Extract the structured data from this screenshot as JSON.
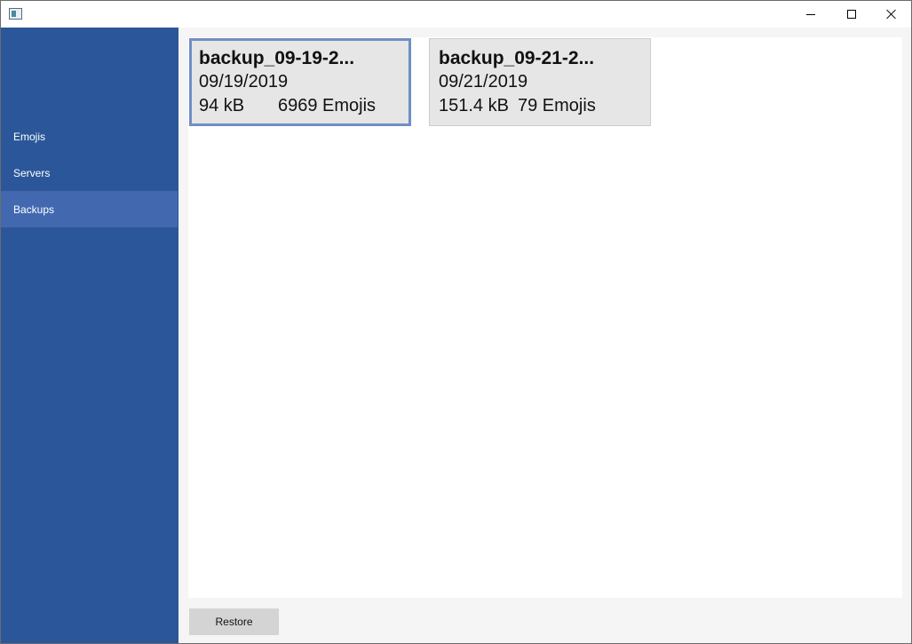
{
  "titlebar": {
    "app_icon": "window-app-icon",
    "buttons": [
      "minimize-icon",
      "maximize-icon",
      "close-icon"
    ]
  },
  "sidebar": {
    "items": [
      {
        "label": "Emojis",
        "active": false
      },
      {
        "label": "Servers",
        "active": false
      },
      {
        "label": "Backups",
        "active": true
      }
    ],
    "color": "#2b579a",
    "active_color": "#4269b0"
  },
  "backups": [
    {
      "name": "backup_09-19-2...",
      "date": "09/19/2019",
      "size": "94 kB",
      "emojis": "6969 Emojis",
      "selected": true
    },
    {
      "name": "backup_09-21-2...",
      "date": "09/21/2019",
      "size": "151.4 kB",
      "emojis": "79 Emojis",
      "selected": false
    }
  ],
  "footer": {
    "restore_label": "Restore"
  },
  "colors": {
    "selection_border": "#6f8fc4",
    "card_background": "#e6e6e6"
  }
}
